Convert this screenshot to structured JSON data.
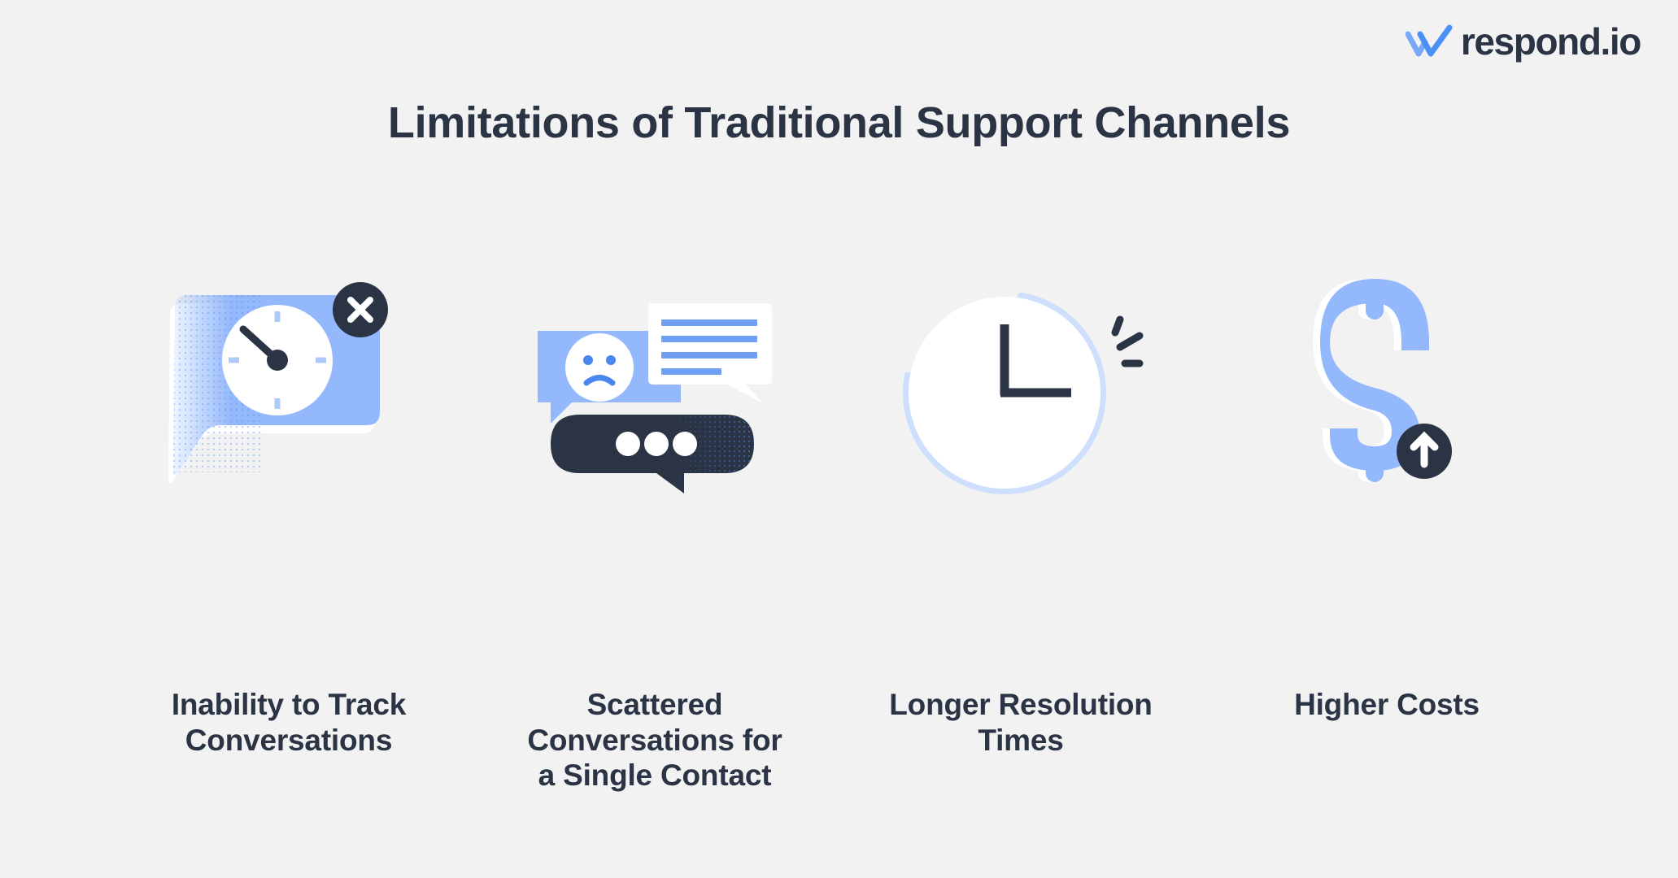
{
  "background_color": "#f2f2f2",
  "brand": {
    "name": "respond.io",
    "logo_icon": "double-check-icon",
    "logo_mark_color": "#4a90f7",
    "text_color": "#2b3445"
  },
  "header": {
    "title": "Limitations of Traditional Support Channels"
  },
  "palette": {
    "light_blue": "#93b8fb",
    "mid_blue": "#6f9ef5",
    "dark_navy": "#2b3445",
    "white": "#ffffff",
    "pale_blue": "#cddffd"
  },
  "items": [
    {
      "icon": "speech-bubble-clock-x-icon",
      "icon_parts": [
        "speech-bubble",
        "clock-face",
        "close-badge"
      ],
      "label": "Inability to Track\nConversations"
    },
    {
      "icon": "scattered-chat-bubbles-icon",
      "icon_parts": [
        "sad-face-bubble",
        "text-lines-bubble",
        "typing-dots-bubble"
      ],
      "label": "Scattered\nConversations for\na Single Contact"
    },
    {
      "icon": "alarm-clock-icon",
      "icon_parts": [
        "clock-ring",
        "clock-hands",
        "motion-marks"
      ],
      "label": "Longer Resolution\nTimes"
    },
    {
      "icon": "dollar-sign-rising-icon",
      "icon_parts": [
        "dollar-sign",
        "arrow-up-badge"
      ],
      "label": "Higher Costs"
    }
  ]
}
